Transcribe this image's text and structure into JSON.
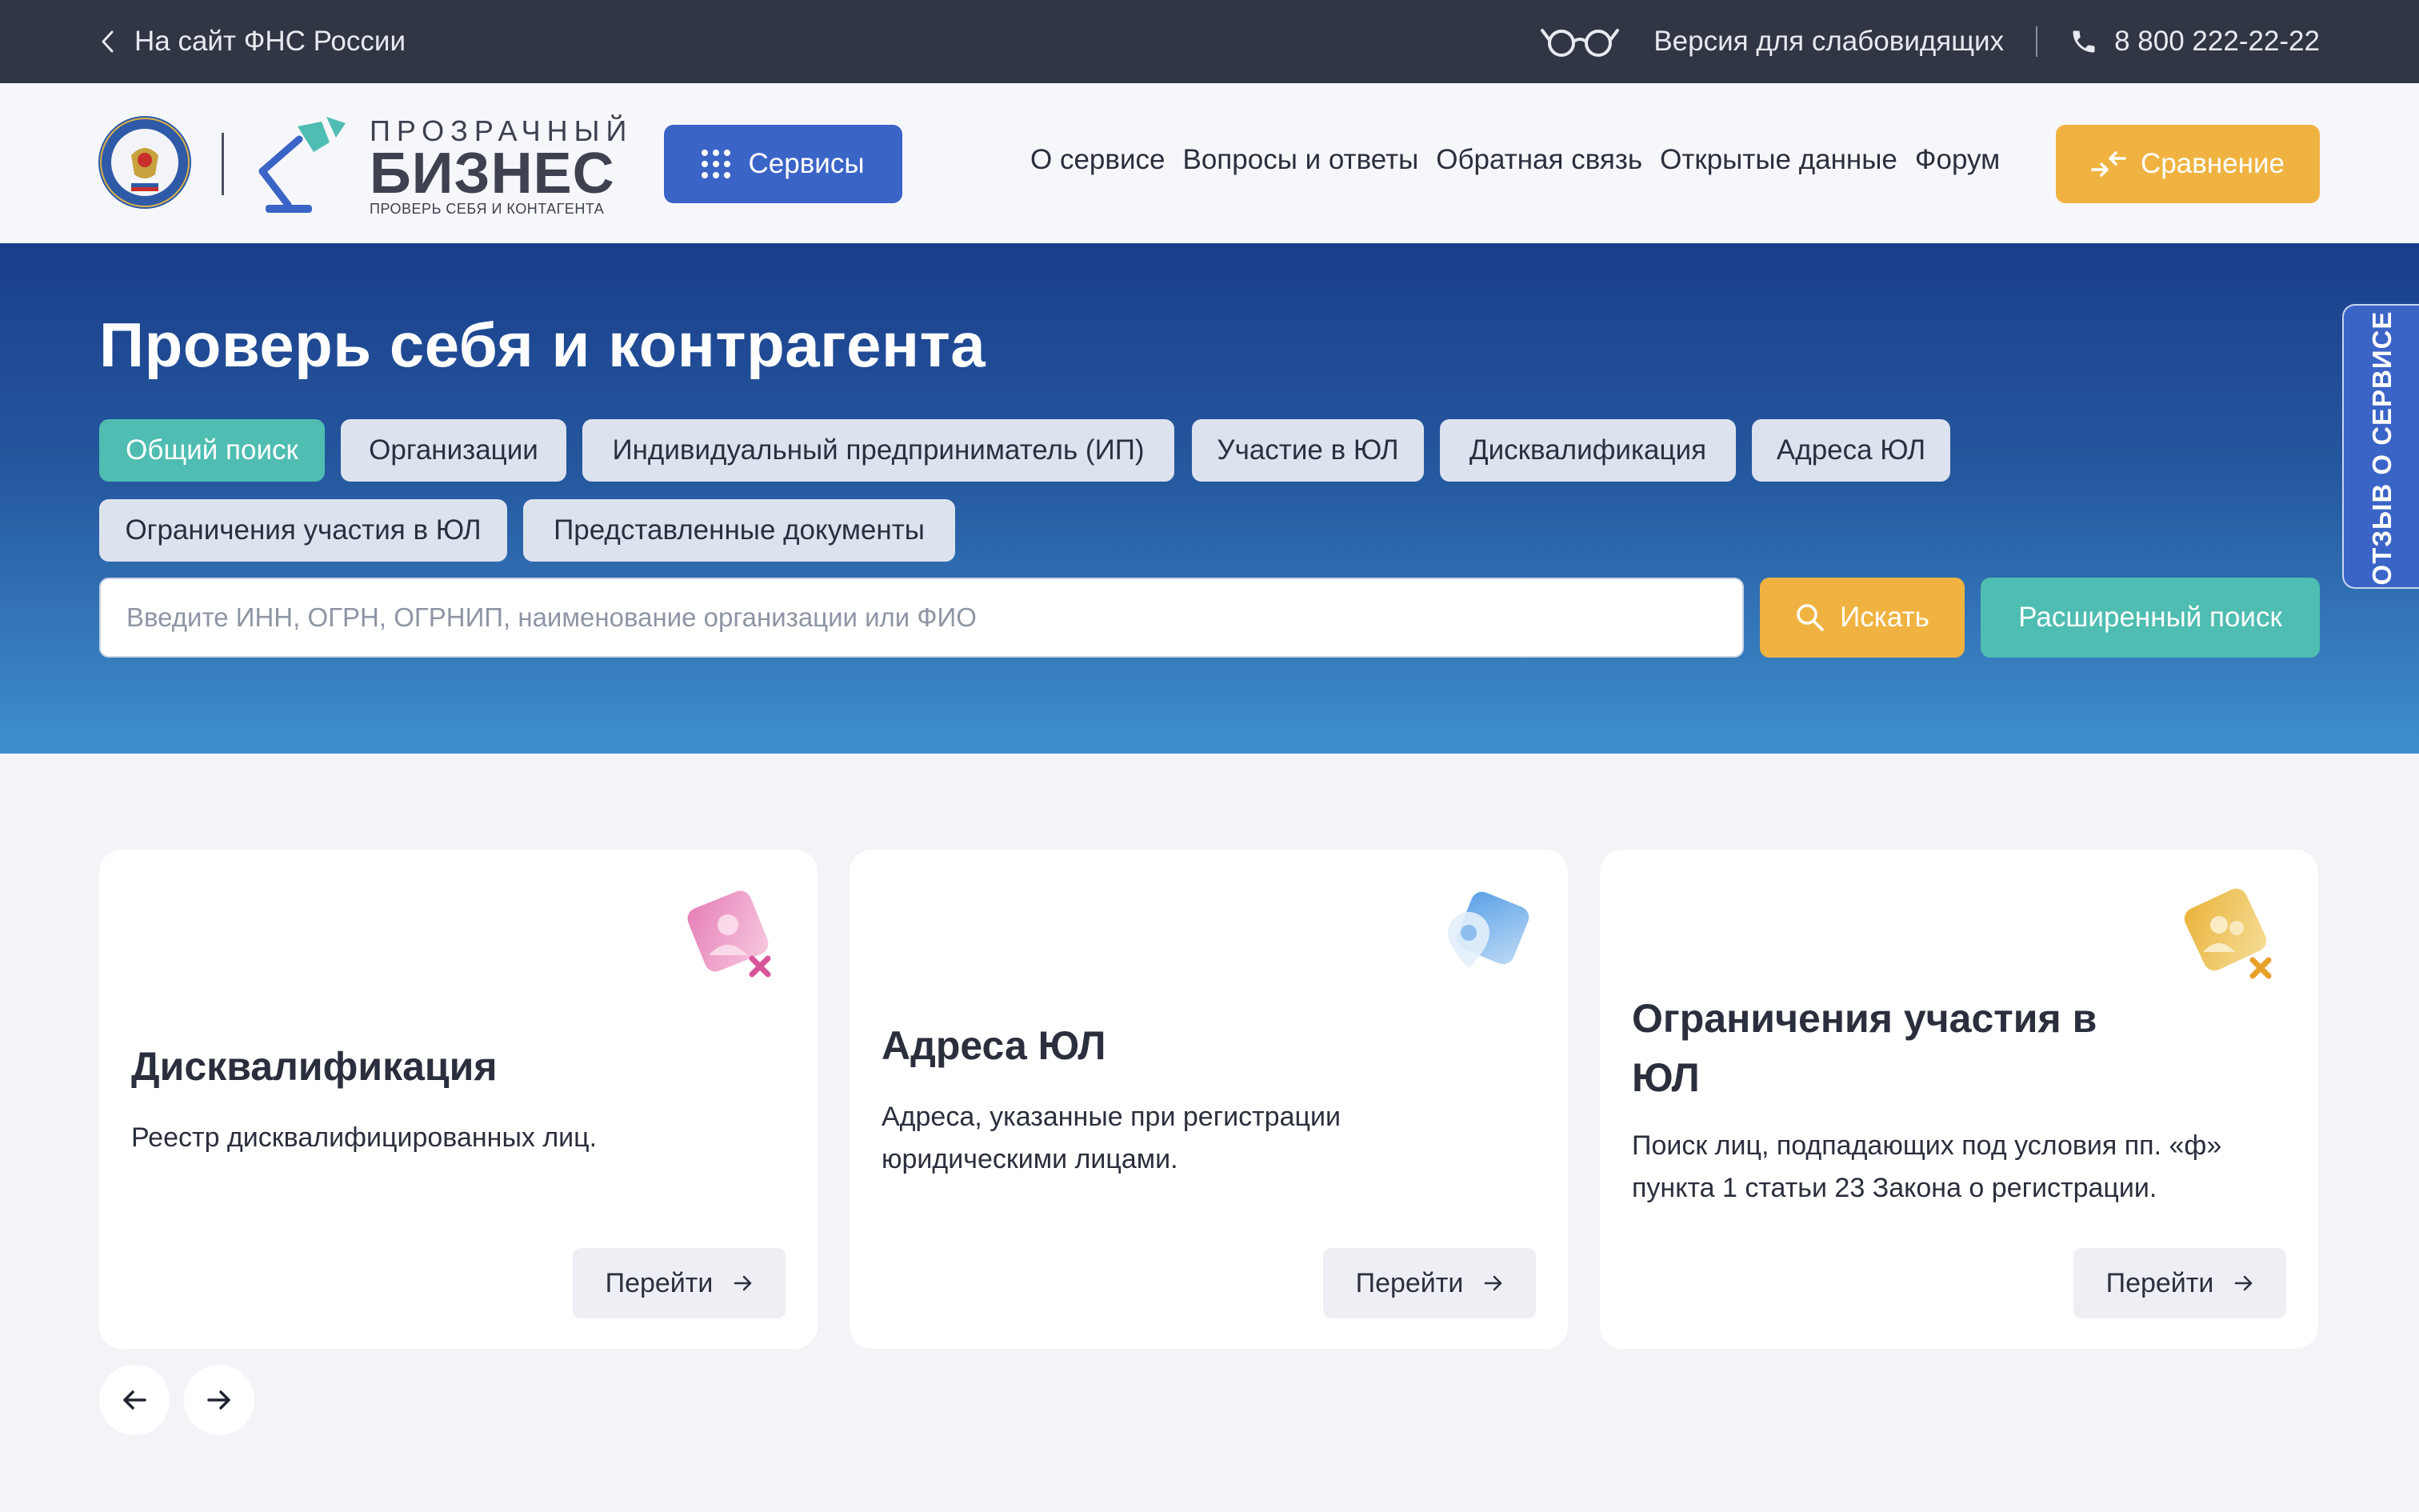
{
  "topbar": {
    "back_link": "На сайт ФНС России",
    "accessibility_link": "Версия для слабовидящих",
    "phone": "8 800 222-22-22"
  },
  "header": {
    "brand_top": "ПРОЗРАЧНЫЙ",
    "brand_main": "БИЗНЕС",
    "brand_sub": "ПРОВЕРЬ СЕБЯ И КОНТАГЕНТА",
    "services_label": "Сервисы",
    "nav": [
      "О сервисе",
      "Вопросы и ответы",
      "Обратная связь",
      "Открытые данные",
      "Форум"
    ],
    "compare_label": "Сравнение"
  },
  "hero": {
    "title": "Проверь себя и контрагента",
    "tabs": [
      "Общий поиск",
      "Организации",
      "Индивидуальный предприниматель (ИП)",
      "Участие в ЮЛ",
      "Дисквалификация",
      "Адреса ЮЛ",
      "Ограничения участия в ЮЛ",
      "Представленные документы"
    ],
    "active_tab": "Общий поиск",
    "search_placeholder": "Введите ИНН, ОГРН, ОГРНИП, наименование организации или ФИО",
    "search_label": "Искать",
    "advanced_label": "Расширенный поиск"
  },
  "feedback_tab": "ОТЗЫВ О СЕРВИСЕ",
  "cards": [
    {
      "title": "Дисквалификация",
      "description": "Реестр дисквалифицированных лиц.",
      "button": "Перейти",
      "icon": "disqualified-person-icon"
    },
    {
      "title": "Адреса ЮЛ",
      "description": "Адреса, указанные при регистрации юридическими лицами.",
      "button": "Перейти",
      "icon": "location-pin-icon"
    },
    {
      "title": "Ограничения участия в ЮЛ",
      "description": "Поиск лиц, подпадающих под условия пп. «ф» пункта 1 статьи 23 Закона о регистрации.",
      "button": "Перейти",
      "icon": "restricted-persons-icon"
    }
  ],
  "colors": {
    "topbar": "#313645",
    "primary_blue": "#3b64c7",
    "accent_orange": "#f0b342",
    "accent_teal": "#4fbdb1",
    "hero_top": "#1b3e8b",
    "hero_bottom": "#3f8fcc"
  }
}
